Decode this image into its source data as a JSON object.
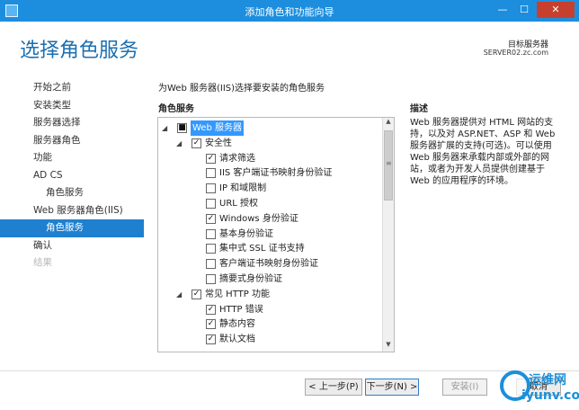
{
  "window": {
    "title": "添加角色和功能向导",
    "minimize": "—",
    "maximize": "☐",
    "close": "✕"
  },
  "header": {
    "page_title": "选择角色服务",
    "target_label": "目标服务器",
    "target_value": "SERVER02.zc.com"
  },
  "sidebar": {
    "items": [
      {
        "label": "开始之前",
        "state": "normal"
      },
      {
        "label": "安装类型",
        "state": "normal"
      },
      {
        "label": "服务器选择",
        "state": "normal"
      },
      {
        "label": "服务器角色",
        "state": "normal"
      },
      {
        "label": "功能",
        "state": "normal"
      },
      {
        "label": "AD CS",
        "state": "normal"
      },
      {
        "label": "角色服务",
        "state": "sub"
      },
      {
        "label": "Web 服务器角色(IIS)",
        "state": "normal"
      },
      {
        "label": "角色服务",
        "state": "sub-active"
      },
      {
        "label": "确认",
        "state": "normal"
      },
      {
        "label": "结果",
        "state": "disabled"
      }
    ]
  },
  "main": {
    "instruction": "为Web 服务器(IIS)选择要安装的角色服务",
    "roles_header": "角色服务",
    "desc_header": "描述",
    "description": "Web 服务器提供对 HTML 网站的支持，以及对 ASP.NET、ASP 和 Web 服务器扩展的支持(可选)。可以使用 Web 服务器来承载内部或外部的网站，或者为开发人员提供创建基于 Web 的应用程序的环境。",
    "tree": [
      {
        "label": "Web 服务器",
        "checked": "■",
        "expander": "◢"
      },
      {
        "label": "安全性",
        "checked": "✓",
        "expander": "◢"
      },
      {
        "label": "请求筛选",
        "checked": "✓",
        "expander": ""
      },
      {
        "label": "IIS 客户端证书映射身份验证",
        "checked": "",
        "expander": ""
      },
      {
        "label": "IP 和域限制",
        "checked": "",
        "expander": ""
      },
      {
        "label": "URL 授权",
        "checked": "",
        "expander": ""
      },
      {
        "label": "Windows 身份验证",
        "checked": "✓",
        "expander": ""
      },
      {
        "label": "基本身份验证",
        "checked": "",
        "expander": ""
      },
      {
        "label": "集中式 SSL 证书支持",
        "checked": "",
        "expander": ""
      },
      {
        "label": "客户端证书映射身份验证",
        "checked": "",
        "expander": ""
      },
      {
        "label": "摘要式身份验证",
        "checked": "",
        "expander": ""
      },
      {
        "label": "常见 HTTP 功能",
        "checked": "✓",
        "expander": "◢"
      },
      {
        "label": "HTTP 错误",
        "checked": "✓",
        "expander": ""
      },
      {
        "label": "静态内容",
        "checked": "✓",
        "expander": ""
      },
      {
        "label": "默认文档",
        "checked": "✓",
        "expander": ""
      }
    ],
    "scroll_up": "▲",
    "scroll_down": "▼",
    "scroll_grip": "≡"
  },
  "footer": {
    "prev": "< 上一步(P)",
    "next": "下一步(N) >",
    "install": "安装(I)",
    "cancel": "取消"
  },
  "watermark": {
    "line1": "运维网",
    "line2": "iyunv.com"
  },
  "colors": {
    "titlebar": "#1d8ede",
    "accent": "#1f80cf",
    "title_text": "#1a6fb0"
  }
}
